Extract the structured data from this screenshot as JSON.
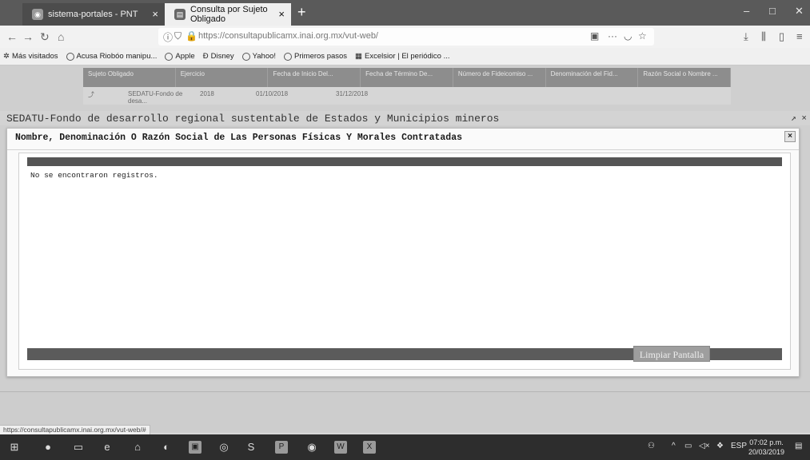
{
  "tabs": [
    {
      "title": "sistema-portales - PNT",
      "close": "×"
    },
    {
      "title": "Consulta por Sujeto Obligado",
      "close": "×"
    }
  ],
  "new_tab": "+",
  "url": "https://consultapublicamx.inai.org.mx/vut-web/",
  "bookmarks": [
    "Más visitados",
    "Acusa Riobóo manipu...",
    "Apple",
    "Disney",
    "Yahoo!",
    "Primeros pasos",
    "Excelsior | El periódico ..."
  ],
  "background_table": {
    "row": [
      "SEDATU-Fondo de desa...",
      "2018",
      "01/10/2018",
      "31/12/2018"
    ],
    "headers": [
      "Sujeto Obligado",
      "Ejercicio",
      "Fecha de Inicio Del...",
      "Fecha de Término De...",
      "Número de Fideicomiso ...",
      "Denominación del Fid...",
      "Razón Social o Nombre ..."
    ]
  },
  "section_title": "SEDATU-Fondo de desarrollo regional sustentable de Estados y Municipios mineros",
  "modal": {
    "title": "Nombre, Denominación O Razón Social de Las Personas Físicas Y Morales Contratadas",
    "close": "×",
    "empty_message": "No se encontraron registros."
  },
  "clear_button": "Limpiar Pantalla",
  "status_link": "https://consultapublicamx.inai.org.mx/vut-web/#",
  "taskbar": {
    "language": "ESP",
    "time": "07:02 p.m.",
    "date": "20/03/2019"
  }
}
